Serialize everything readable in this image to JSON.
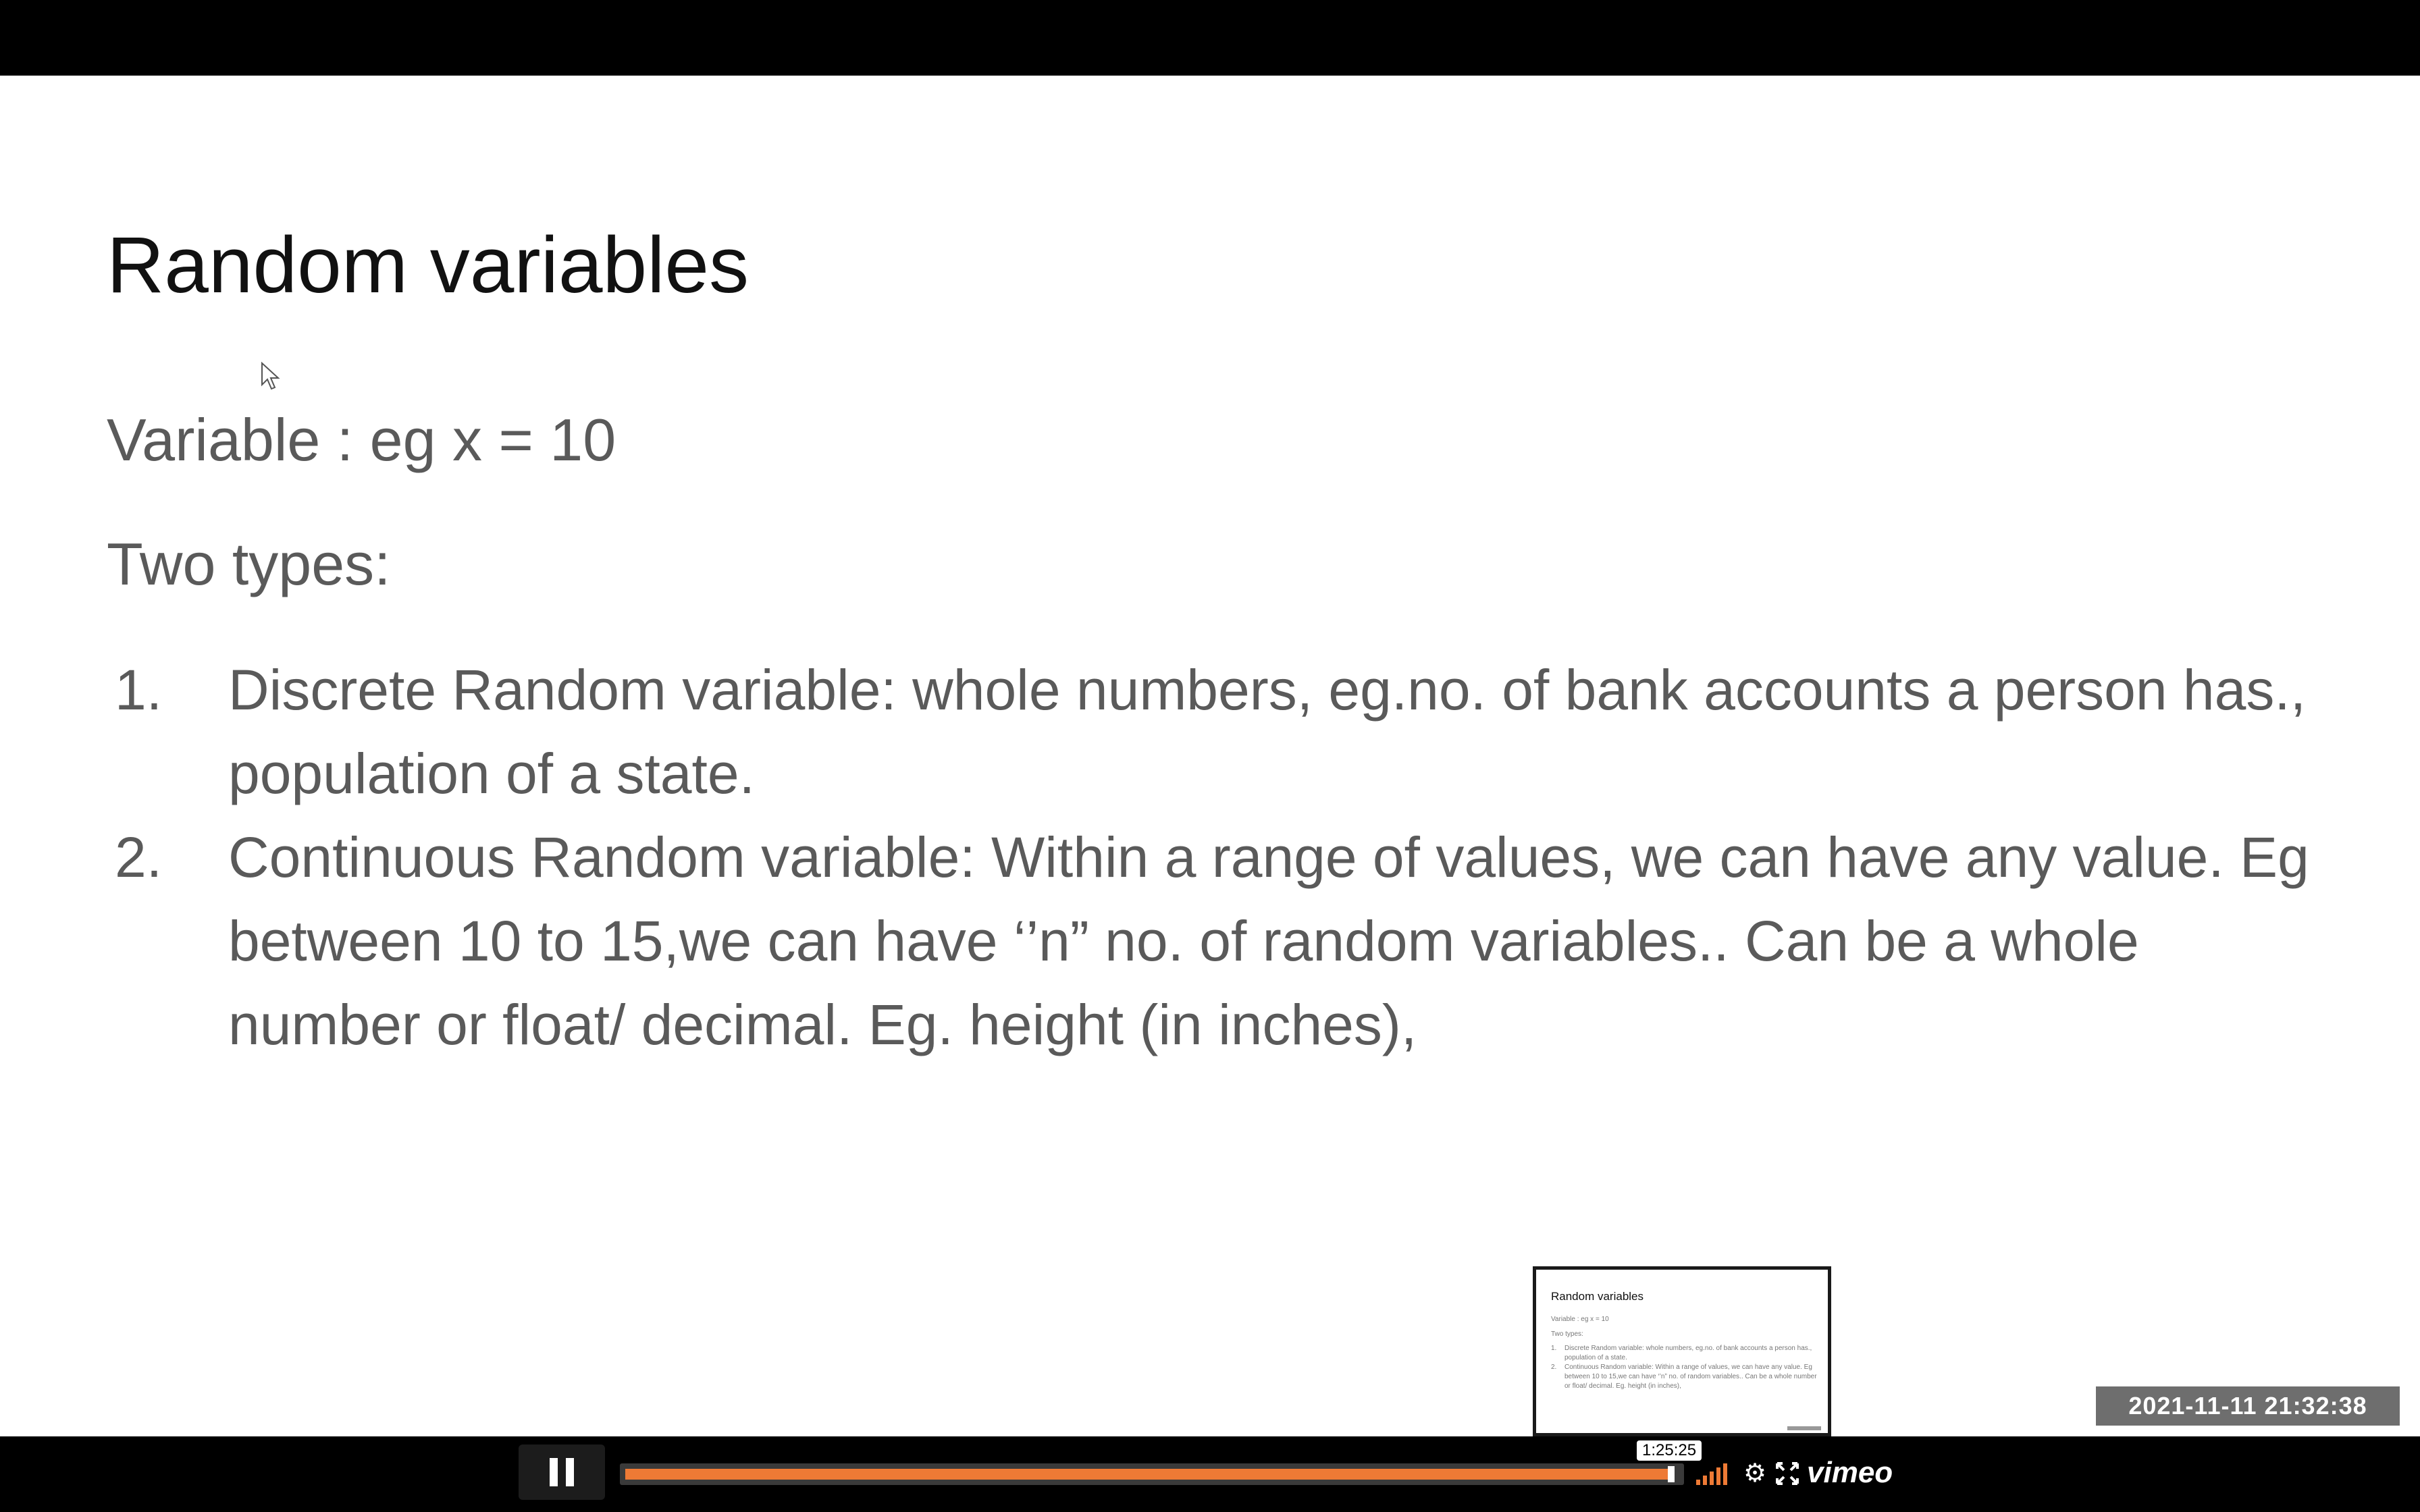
{
  "slide": {
    "title": "Random variables",
    "variable_line": "Variable : eg x = 10",
    "types_heading": "Two types:",
    "items": [
      {
        "number": "1.",
        "text": "Discrete Random variable: whole numbers, eg.no. of bank accounts a person has., population of a state."
      },
      {
        "number": "2.",
        "text": "Continuous Random variable: Within a range of values, we can have any value. Eg between 10 to 15,we can have ‘’n” no. of random variables.. Can be a whole number or float/ decimal. Eg. height (in inches),"
      }
    ]
  },
  "thumbnail": {
    "title": "Random variables",
    "variable_line": "Variable : eg x = 10",
    "types_heading": "Two types:",
    "items": [
      {
        "number": "1.",
        "text": "Discrete Random variable: whole numbers, eg.no. of bank accounts a person has., population of a state."
      },
      {
        "number": "2.",
        "text": "Continuous Random variable: Within a range of values, we can have any value. Eg between 10 to 15,we can have ‘’n” no. of random variables.. Can be a whole number or float/ decimal. Eg. height (in inches),"
      }
    ]
  },
  "overlay": {
    "timestamp": "2021-11-11  21:32:38"
  },
  "player": {
    "hover_time": "1:25:25",
    "progress_fraction": 0.993,
    "logo": "vimeo",
    "icons": {
      "play_pause": "pause-icon",
      "volume": "volume-icon",
      "settings": "gear-icon",
      "fullscreen": "fullscreen-icon"
    },
    "accent_color": "#ee7a35"
  }
}
